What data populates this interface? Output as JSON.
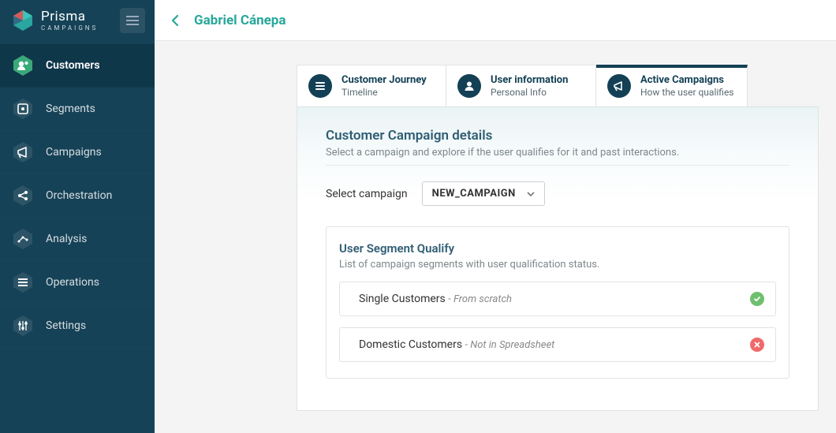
{
  "brand": {
    "name": "Prisma",
    "sub": "CAMPAIGNS"
  },
  "sidebar": {
    "items": [
      {
        "label": "Customers"
      },
      {
        "label": "Segments"
      },
      {
        "label": "Campaigns"
      },
      {
        "label": "Orchestration"
      },
      {
        "label": "Analysis"
      },
      {
        "label": "Operations"
      },
      {
        "label": "Settings"
      }
    ]
  },
  "header": {
    "title": "Gabriel Cánepa"
  },
  "tabs": [
    {
      "title": "Customer Journey",
      "sub": "Timeline"
    },
    {
      "title": "User information",
      "sub": "Personal Info"
    },
    {
      "title": "Active Campaigns",
      "sub": "How the user qualifies"
    }
  ],
  "details": {
    "title": "Customer Campaign details",
    "sub": "Select a campaign and explore if the user qualifies for it and past interactions."
  },
  "select": {
    "label": "Select campaign",
    "value": "NEW_CAMPAIGN"
  },
  "qualify": {
    "title": "User Segment Qualify",
    "sub": "List of campaign segments with user qualification status.",
    "rows": [
      {
        "name": "Single Customers",
        "note": "From scratch",
        "status": "ok"
      },
      {
        "name": "Domestic Customers",
        "note": "Not in Spreadsheet",
        "status": "bad"
      }
    ]
  }
}
